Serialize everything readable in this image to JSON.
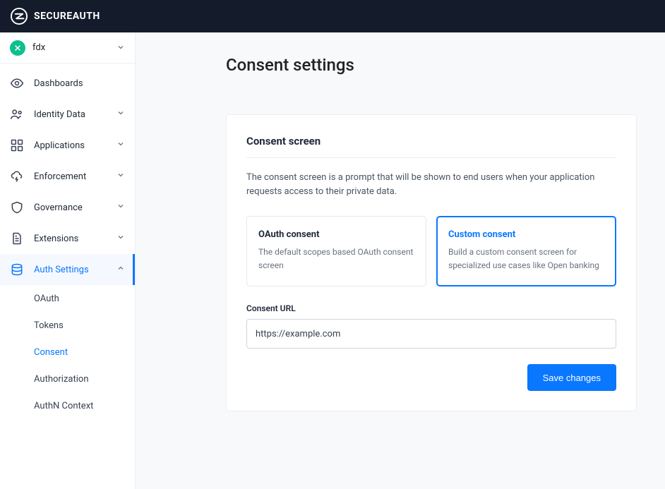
{
  "brand": "SECUREAUTH",
  "workspace": {
    "label": "fdx"
  },
  "sidebar": {
    "items": [
      {
        "label": "Dashboards",
        "expandable": false
      },
      {
        "label": "Identity Data",
        "expandable": true
      },
      {
        "label": "Applications",
        "expandable": true
      },
      {
        "label": "Enforcement",
        "expandable": true
      },
      {
        "label": "Governance",
        "expandable": true
      },
      {
        "label": "Extensions",
        "expandable": true
      },
      {
        "label": "Auth Settings",
        "expandable": true,
        "active": true
      }
    ],
    "auth_settings_children": [
      {
        "label": "OAuth"
      },
      {
        "label": "Tokens"
      },
      {
        "label": "Consent",
        "active": true
      },
      {
        "label": "Authorization"
      },
      {
        "label": "AuthN Context"
      }
    ]
  },
  "page": {
    "title": "Consent settings",
    "section_title": "Consent screen",
    "section_desc": "The consent screen is a prompt that will be shown to end users when your application requests access to their private data.",
    "options": [
      {
        "title": "OAuth consent",
        "desc": "The default scopes based OAuth consent screen",
        "selected": false
      },
      {
        "title": "Custom consent",
        "desc": "Build a custom consent screen for specialized use cases like Open banking",
        "selected": true
      }
    ],
    "consent_url_label": "Consent URL",
    "consent_url_value": "https://example.com",
    "save_label": "Save changes"
  }
}
